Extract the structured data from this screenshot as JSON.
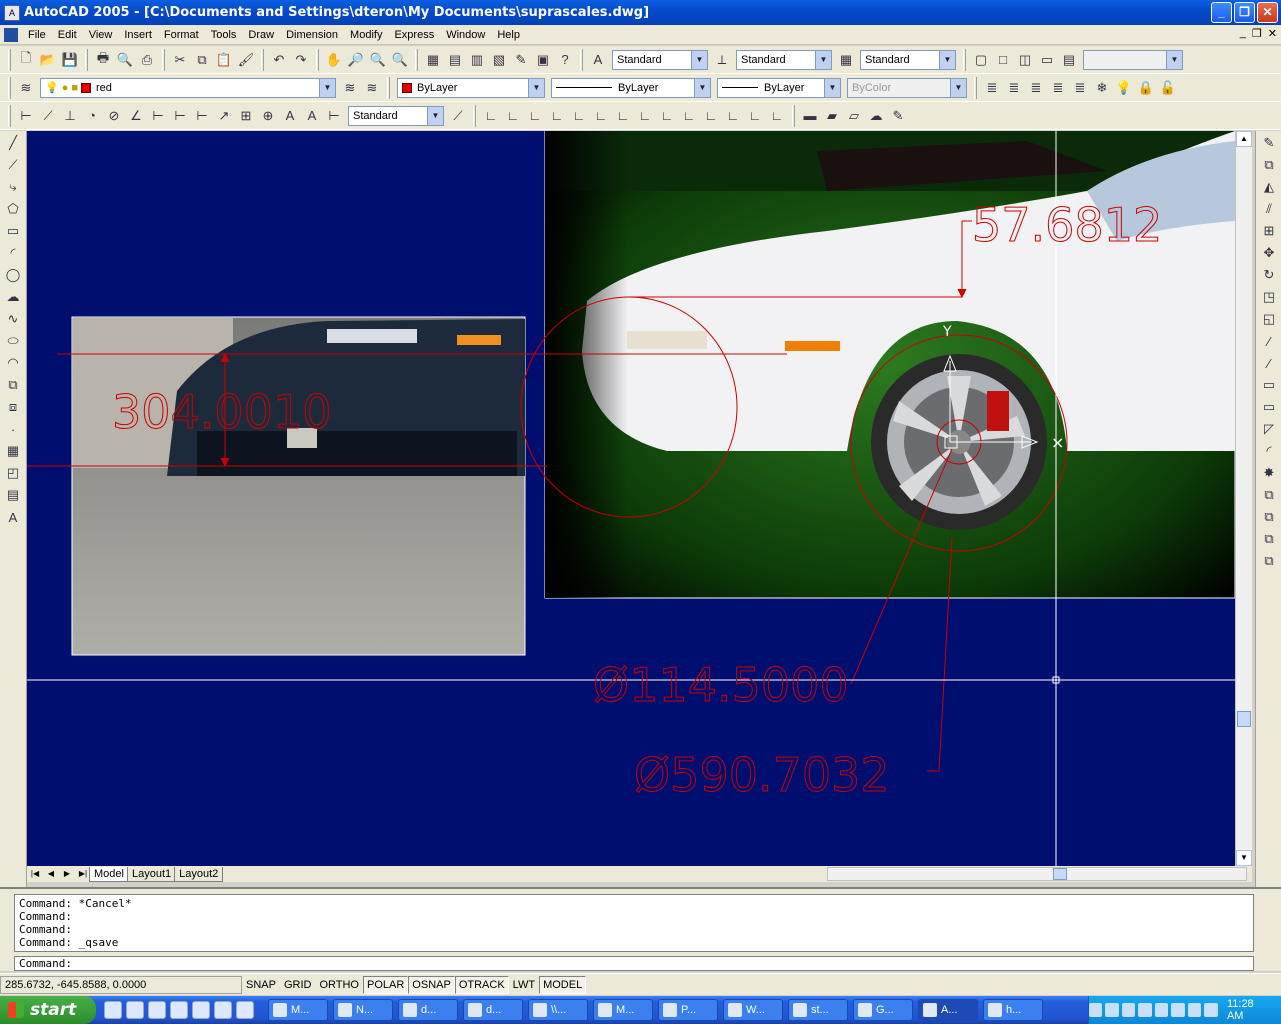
{
  "window": {
    "title": "AutoCAD 2005 - [C:\\Documents and Settings\\dteron\\My Documents\\suprascales.dwg]"
  },
  "menu": [
    "File",
    "Edit",
    "View",
    "Insert",
    "Format",
    "Tools",
    "Draw",
    "Dimension",
    "Modify",
    "Express",
    "Window",
    "Help"
  ],
  "styles": {
    "text_style": "Standard",
    "dim_style": "Standard",
    "table_style": "Standard"
  },
  "layers": {
    "current_layer": "red",
    "color": "ByLayer",
    "linetype": "ByLayer",
    "lineweight": "ByLayer",
    "plot_style": "ByColor"
  },
  "dimtoolbar": {
    "dim_style": "Standard"
  },
  "drawing": {
    "dimension_texts": [
      "57.6812",
      "304.0010",
      "Ø114.5000",
      "Ø590.7032"
    ],
    "colors": {
      "background": "#000e70",
      "dimension": "#cc0000",
      "crosshair": "#ffffff"
    }
  },
  "tabs": [
    "Model",
    "Layout1",
    "Layout2"
  ],
  "command_history": [
    "Command: *Cancel*",
    "Command:",
    "Command:",
    "Command: _qsave"
  ],
  "command_prompt": "Command:",
  "status": {
    "coords": "285.6732, -645.8588, 0.0000",
    "toggles": [
      "SNAP",
      "GRID",
      "ORTHO",
      "POLAR",
      "OSNAP",
      "OTRACK",
      "LWT",
      "MODEL"
    ]
  },
  "taskbar": {
    "start": "start",
    "tasks": [
      "M...",
      "N...",
      "d...",
      "d...",
      "\\\\...",
      "M...",
      "P...",
      "W...",
      "st...",
      "G...",
      "A...",
      "h..."
    ],
    "clock": "11:28 AM"
  }
}
